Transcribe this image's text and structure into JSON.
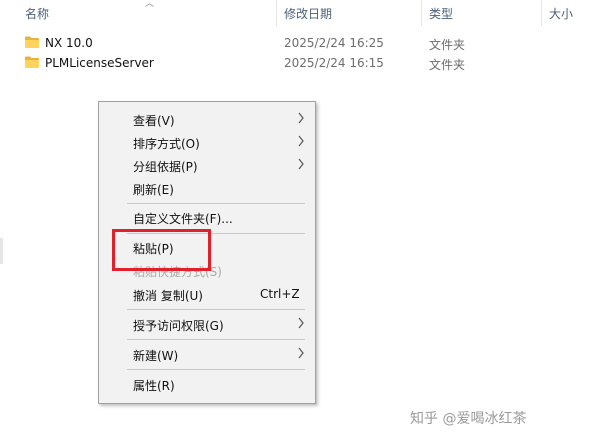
{
  "columns": {
    "name": "名称",
    "modified": "修改日期",
    "type": "类型",
    "size": "大小"
  },
  "files": [
    {
      "name": "NX 10.0",
      "modified": "2025/2/24 16:25",
      "type": "文件夹",
      "icon": "folder-icon"
    },
    {
      "name": "PLMLicenseServer",
      "modified": "2025/2/24 16:15",
      "type": "文件夹",
      "icon": "folder-icon"
    }
  ],
  "context_menu": {
    "view": "查看(V)",
    "sort_by": "排序方式(O)",
    "group_by": "分组依据(P)",
    "refresh": "刷新(E)",
    "customize": "自定义文件夹(F)...",
    "paste": "粘贴(P)",
    "paste_shortcut": "粘贴快捷方式(S)",
    "undo": "撤消 复制(U)",
    "undo_shortcut": "Ctrl+Z",
    "give_access": "授予访问权限(G)",
    "new": "新建(W)",
    "properties": "属性(R)"
  },
  "annotation_color": "#e0202a",
  "watermark": "知乎 @爱喝冰红茶"
}
